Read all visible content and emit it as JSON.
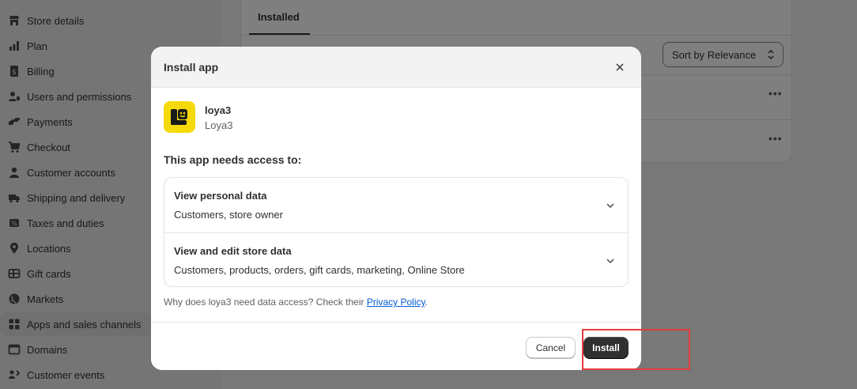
{
  "sidebar": {
    "items": [
      {
        "label": "Store details",
        "icon": "store-icon"
      },
      {
        "label": "Plan",
        "icon": "plan-chart-icon"
      },
      {
        "label": "Billing",
        "icon": "billing-receipt-icon"
      },
      {
        "label": "Users and permissions",
        "icon": "users-icon"
      },
      {
        "label": "Payments",
        "icon": "payments-icon"
      },
      {
        "label": "Checkout",
        "icon": "cart-icon"
      },
      {
        "label": "Customer accounts",
        "icon": "person-icon"
      },
      {
        "label": "Shipping and delivery",
        "icon": "truck-icon"
      },
      {
        "label": "Taxes and duties",
        "icon": "taxes-icon"
      },
      {
        "label": "Locations",
        "icon": "location-pin-icon"
      },
      {
        "label": "Gift cards",
        "icon": "gift-card-icon"
      },
      {
        "label": "Markets",
        "icon": "globe-icon"
      },
      {
        "label": "Apps and sales channels",
        "icon": "apps-icon"
      },
      {
        "label": "Domains",
        "icon": "domains-icon"
      },
      {
        "label": "Customer events",
        "icon": "events-icon"
      }
    ],
    "active_index": 12
  },
  "background": {
    "tab_installed": "Installed",
    "sort_label": "Sort by Relevance",
    "row_menu": "•••"
  },
  "modal": {
    "title": "Install app",
    "app_name": "loya3",
    "app_developer": "Loya3",
    "needs_access_heading": "This app needs access to:",
    "access": [
      {
        "title": "View personal data",
        "description": "Customers, store owner"
      },
      {
        "title": "View and edit store data",
        "description": "Customers, products, orders, gift cards, marketing, Online Store"
      }
    ],
    "why_text": "Why does loya3 need data access? Check their ",
    "privacy_link": "Privacy Policy",
    "why_end": ".",
    "cancel_label": "Cancel",
    "install_label": "Install"
  },
  "colors": {
    "app_logo_bg": "#f5d90a",
    "primary_button": "#303030",
    "link": "#005bd3",
    "highlight": "#e23c3c"
  }
}
